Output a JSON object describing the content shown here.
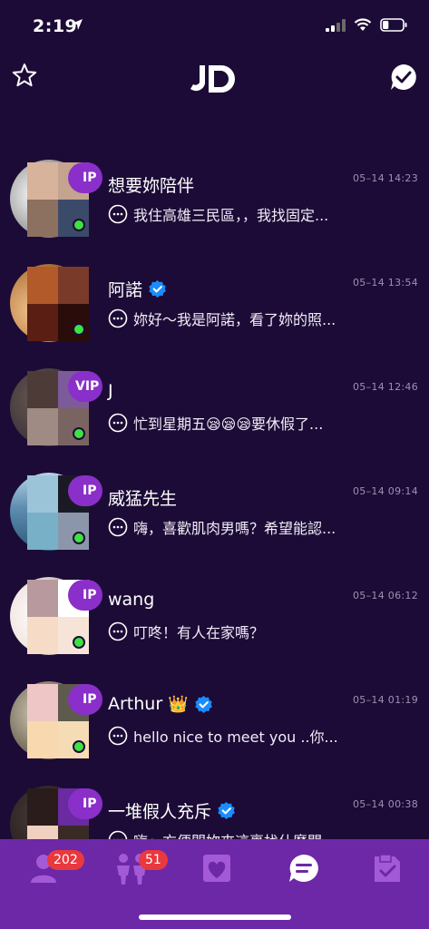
{
  "status_bar": {
    "time": "2:19",
    "battery_level": 0.3
  },
  "header": {
    "logo_text": "JD"
  },
  "colors": {
    "background": "#1c0b36",
    "tab_bar": "#6c28a6",
    "vip": "#8a2fc9",
    "online": "#3ee241",
    "badge": "#e8393f",
    "verified": "#1a8cff"
  },
  "conversations": [
    {
      "name": "想要妳陪伴",
      "verified": false,
      "vip": true,
      "vip_label": "IP",
      "online": true,
      "time": "05–14   14:23",
      "preview": "我住高雄三民區，，我找固定...",
      "preview_icon": "chat-bubble-icon"
    },
    {
      "name": "阿諾",
      "verified": true,
      "vip": false,
      "online": true,
      "time": "05–14   13:54",
      "preview": "妳好～我是阿諾，看了妳的照...",
      "preview_icon": "chat-bubble-icon"
    },
    {
      "name": "J",
      "verified": false,
      "vip": true,
      "vip_label": "VIP",
      "online": true,
      "time": "05–14   12:46",
      "preview": "忙到星期五😪😪😪要休假了...",
      "preview_icon": "chat-bubble-icon"
    },
    {
      "name": "威猛先生",
      "verified": false,
      "vip": true,
      "vip_label": "IP",
      "online": true,
      "time": "05–14   09:14",
      "preview": "嗨，喜歡肌肉男嗎？希望能認...",
      "preview_icon": "chat-bubble-icon"
    },
    {
      "name": "wang",
      "verified": false,
      "vip": true,
      "vip_label": "IP",
      "online": true,
      "time": "05–14   06:12",
      "preview": "叮咚！有人在家嗎？",
      "preview_icon": "chat-bubble-icon"
    },
    {
      "name": "Arthur",
      "crown": "👑",
      "verified": true,
      "vip": true,
      "vip_label": "IP",
      "online": true,
      "time": "05–14   01:19",
      "preview": "hello nice to meet you ..你...",
      "preview_icon": "chat-bubble-icon"
    },
    {
      "name": "一堆假人充斥",
      "verified": true,
      "vip": true,
      "vip_label": "IP",
      "online": false,
      "time": "05–14   00:38",
      "preview": "嗨～方便問妳來這裏找什麼關...",
      "preview_icon": "chat-bubble-icon"
    }
  ],
  "tabs": [
    {
      "icon": "person-icon",
      "badge": "202"
    },
    {
      "icon": "couple-icon",
      "badge": "51"
    },
    {
      "icon": "heart-card-icon",
      "badge": ""
    },
    {
      "icon": "messages-icon",
      "badge": "",
      "active": true
    },
    {
      "icon": "tag-check-icon",
      "badge": ""
    }
  ]
}
